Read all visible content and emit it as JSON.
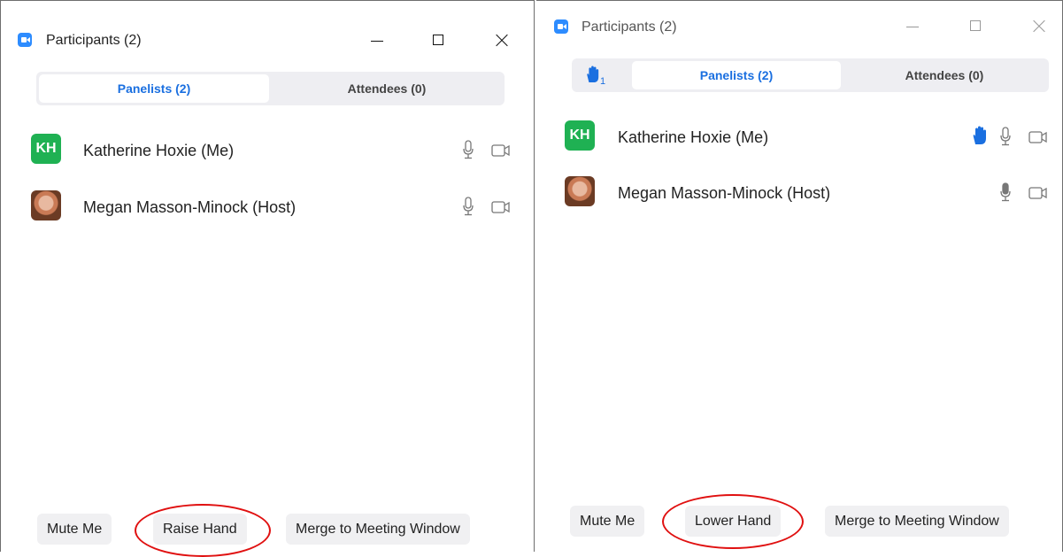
{
  "left": {
    "title": "Participants (2)",
    "tabs": [
      {
        "label": "Panelists (2)"
      },
      {
        "label": "Attendees (0)"
      }
    ],
    "participants": [
      {
        "initials": "KH",
        "name": "Katherine Hoxie (Me)"
      },
      {
        "name": "Megan Masson-Minock (Host)"
      }
    ],
    "buttons": {
      "mute": "Mute Me",
      "hand": "Raise Hand",
      "merge": "Merge to Meeting Window"
    }
  },
  "right": {
    "title": "Participants (2)",
    "raised_hands_count": "1",
    "tabs": [
      {
        "label": "Panelists (2)"
      },
      {
        "label": "Attendees (0)"
      }
    ],
    "participants": [
      {
        "initials": "KH",
        "name": "Katherine Hoxie (Me)"
      },
      {
        "name": "Megan Masson-Minock (Host)"
      }
    ],
    "buttons": {
      "mute": "Mute Me",
      "hand": "Lower Hand",
      "merge": "Merge to Meeting Window"
    }
  },
  "colors": {
    "accent": "#1a6fe0",
    "zoom_blue": "#2d8cff",
    "avatar_green": "#1fb153",
    "highlight": "#e01010"
  },
  "icons": [
    "zoom-app-icon",
    "minimize-icon",
    "maximize-icon",
    "close-icon",
    "microphone-icon",
    "camera-icon",
    "raised-hand-icon"
  ]
}
